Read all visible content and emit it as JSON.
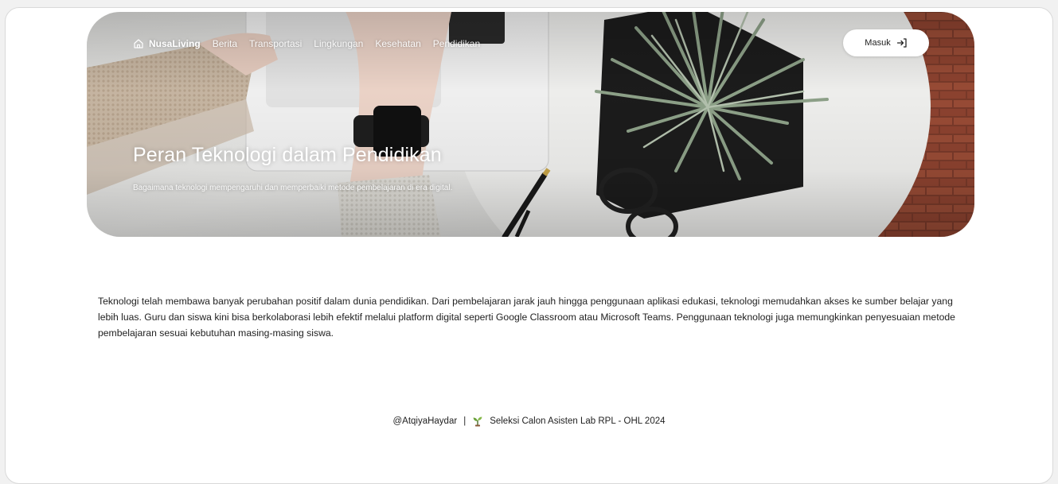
{
  "nav": {
    "brand": "NusaLiving",
    "links": [
      "Berita",
      "Transportasi",
      "Lingkungan",
      "Kesehatan",
      "Pendidikan"
    ],
    "login_label": "Masuk",
    "icons": {
      "brand": "home-icon",
      "login": "login-arrow-icon"
    }
  },
  "hero": {
    "title": "Peran Teknologi dalam Pendidikan",
    "subtitle": "Bagaimana teknologi mempengaruhi dan memperbaiki metode pembelajaran di era digital."
  },
  "article": {
    "body": "Teknologi telah membawa banyak perubahan positif dalam dunia pendidikan. Dari pembelajaran jarak jauh hingga penggunaan aplikasi edukasi, teknologi memudahkan akses ke sumber belajar yang lebih luas. Guru dan siswa kini bisa berkolaborasi lebih efektif melalui platform digital seperti Google Classroom atau Microsoft Teams. Penggunaan teknologi juga memungkinkan penyesuaian metode pembelajaran sesuai kebutuhan masing-masing siswa."
  },
  "footer": {
    "handle": "@AtqiyaHaydar",
    "separator": "|",
    "text": "Seleksi Calon Asisten Lab RPL - OHL 2024",
    "icon": "sprout-icon"
  },
  "colors": {
    "page_bg": "#ffffff",
    "text": "#222222",
    "button_bg": "#ffffff"
  }
}
